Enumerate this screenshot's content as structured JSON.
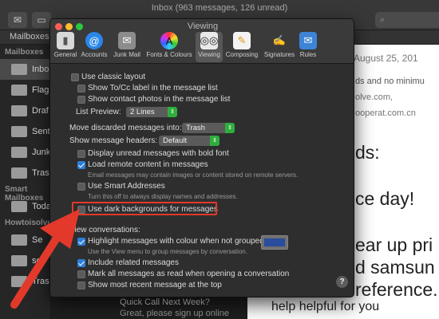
{
  "mail": {
    "window_title": "Inbox (963 messages, 126 unread)",
    "favorites_bar": {
      "mailboxes_label": "Mailboxes",
      "flag_label": "Flag"
    },
    "sidebar": {
      "section_mailboxes": "Mailboxes",
      "items": [
        {
          "label": "Inbo",
          "icon": "inbox-icon"
        },
        {
          "label": "Flag",
          "icon": "flag-icon"
        },
        {
          "label": "Draf",
          "icon": "drafts-icon"
        },
        {
          "label": "Sent",
          "icon": "sent-icon"
        },
        {
          "label": "Junk",
          "icon": "junk-icon"
        },
        {
          "label": "Trash",
          "icon": "trash-icon"
        }
      ],
      "section_smart": "Smart Mailboxes",
      "smart_items": [
        {
          "label": "Toda",
          "icon": "smart-mailbox-icon"
        }
      ],
      "section_account": "Howtoisolve",
      "account_items": [
        {
          "label": "Se",
          "icon": "folder-icon"
        },
        {
          "label": "se",
          "icon": "folder-icon"
        },
        {
          "label": "Trash",
          "icon": "trash-icon"
        }
      ]
    },
    "message_list_visible": [
      {
        "text": "Quick Call Next Week?"
      },
      {
        "text": "Great, please sign up online"
      }
    ],
    "reader": {
      "date": "August 25, 201",
      "sender_fragment": "n",
      "snippet_lines": [
        "ds and no minimu",
        "olve.com,",
        "ooperat.com.cn"
      ],
      "body_lines": [
        "ds:",
        "ce day!",
        "ear up pri",
        "d samsun",
        "reference.",
        "help helpful for you"
      ]
    }
  },
  "prefs": {
    "title": "Viewing",
    "tabs": [
      {
        "label": "General",
        "icon": "general-icon"
      },
      {
        "label": "Accounts",
        "icon": "at-sign-icon"
      },
      {
        "label": "Junk Mail",
        "icon": "junk-mail-icon"
      },
      {
        "label": "Fonts & Colours",
        "icon": "color-wheel-icon"
      },
      {
        "label": "Viewing",
        "icon": "glasses-icon",
        "active": true
      },
      {
        "label": "Composing",
        "icon": "pencil-icon"
      },
      {
        "label": "Signatures",
        "icon": "signature-icon"
      },
      {
        "label": "Rules",
        "icon": "rules-icon"
      }
    ],
    "use_classic_layout": {
      "label": "Use classic layout",
      "checked": false
    },
    "show_tocc": {
      "label": "Show To/Cc label in the message list",
      "checked": false
    },
    "show_contact_photos": {
      "label": "Show contact photos in the message list",
      "checked": false
    },
    "list_preview": {
      "label": "List Preview:",
      "value": "2 Lines"
    },
    "move_discarded": {
      "label": "Move discarded messages into:",
      "value": "Trash"
    },
    "show_headers": {
      "label": "Show message headers:",
      "value": "Default"
    },
    "unread_bold": {
      "label": "Display unread messages with bold font",
      "checked": false
    },
    "load_remote": {
      "label": "Load remote content in messages",
      "checked": true,
      "note": "Email messages may contain images or content stored on remote servers."
    },
    "smart_addresses": {
      "label": "Use Smart Addresses",
      "checked": false,
      "note": "Turn this off to always display names and addresses."
    },
    "dark_backgrounds": {
      "label": "Use dark backgrounds for messages",
      "checked": false
    },
    "conversations_heading": "View conversations:",
    "highlight": {
      "label": "Highlight messages with colour when not grouped",
      "checked": true,
      "note": "Use the View menu to group messages by conversation.",
      "color": "#2a4c9c"
    },
    "include_related": {
      "label": "Include related messages",
      "checked": true
    },
    "mark_all_read": {
      "label": "Mark all messages as read when opening a conversation",
      "checked": false
    },
    "most_recent_top": {
      "label": "Show most recent message at the top",
      "checked": false
    },
    "help_label": "?"
  },
  "colors": {
    "annotation_red": "#e2392b",
    "accent_blue": "#2d7fd8",
    "popup_green": "#2fae3e"
  }
}
